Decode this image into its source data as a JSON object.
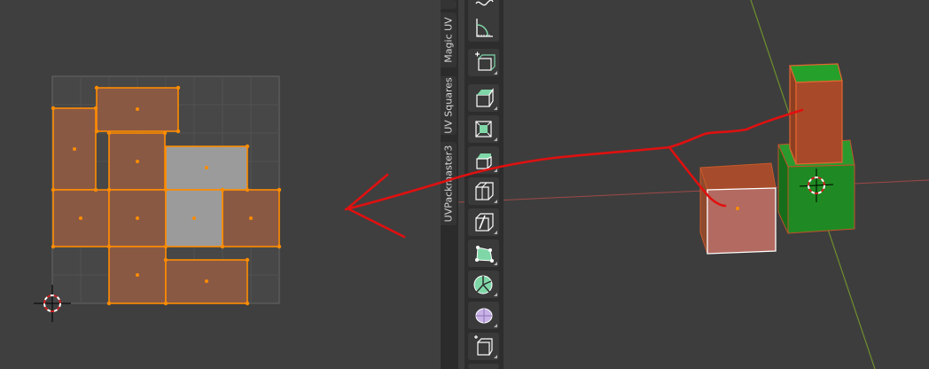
{
  "sidebar_tabs": [
    {
      "label": "Magic UV"
    },
    {
      "label": "UV Squares"
    },
    {
      "label": "UVPackmaster3"
    }
  ],
  "uv_editor": {
    "selected_faces": 8,
    "unselected_faces": 2
  },
  "toolbar": {
    "tools": [
      {
        "name": "transform-tool"
      },
      {
        "name": "measure-tool"
      },
      {
        "name": "add-cube-tool"
      },
      {
        "name": "extrude-region-tool"
      },
      {
        "name": "inset-faces-tool"
      },
      {
        "name": "bevel-tool"
      },
      {
        "name": "loop-cut-tool"
      },
      {
        "name": "knife-tool"
      },
      {
        "name": "poly-build-tool"
      },
      {
        "name": "spin-tool"
      },
      {
        "name": "smooth-tool"
      },
      {
        "name": "shrink-fatten-tool"
      }
    ]
  },
  "colors": {
    "uv_face_selected": "#8a5944",
    "uv_face_unselected": "#9b9b9b",
    "uv_edge_selected": "#ff8c00",
    "annotation": "#e01010",
    "cube_green": "#1f8a23",
    "cube_orange": "#c0502a",
    "x_axis": "#a04848",
    "y_axis": "#6f8f2e"
  }
}
